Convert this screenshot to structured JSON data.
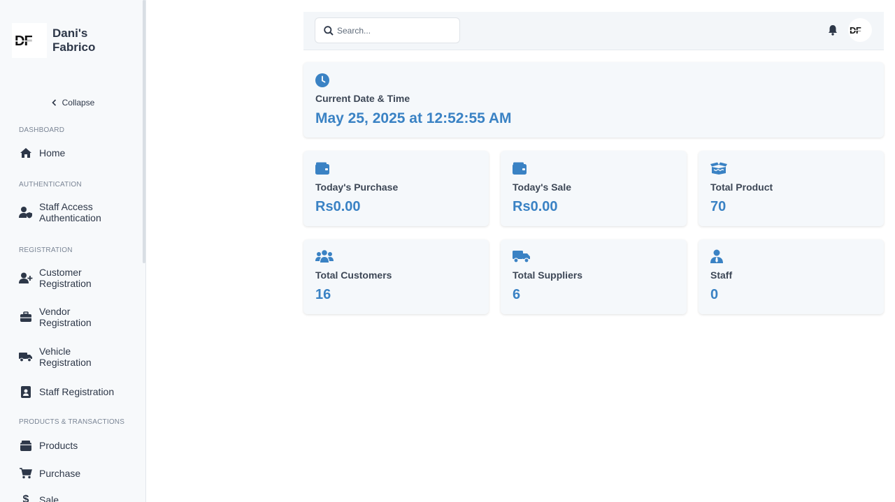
{
  "brand": {
    "name": "Dani's Fabrico",
    "logo_text": "DF"
  },
  "sidebar": {
    "collapse_label": "Collapse",
    "sections": [
      {
        "title": "DASHBOARD",
        "items": [
          {
            "label": "Home",
            "icon": "home-icon"
          }
        ]
      },
      {
        "title": "AUTHENTICATION",
        "items": [
          {
            "label": "Staff Access Authentication",
            "icon": "user-shield-icon"
          }
        ]
      },
      {
        "title": "REGISTRATION",
        "items": [
          {
            "label": "Customer Registration",
            "icon": "user-plus-icon"
          },
          {
            "label": "Vendor Registration",
            "icon": "briefcase-icon"
          },
          {
            "label": "Vehicle Registration",
            "icon": "truck-icon"
          },
          {
            "label": "Staff Registration",
            "icon": "id-badge-icon"
          }
        ]
      },
      {
        "title": "PRODUCTS & TRANSACTIONS",
        "items": [
          {
            "label": "Products",
            "icon": "box-icon"
          },
          {
            "label": "Purchase",
            "icon": "cart-icon"
          },
          {
            "label": "Sale",
            "icon": "dollar-icon"
          }
        ]
      }
    ]
  },
  "header": {
    "search_placeholder": "Search..."
  },
  "datetime_card": {
    "title": "Current Date & Time",
    "value": "May 25, 2025 at 12:52:55 AM",
    "icon": "clock-icon"
  },
  "stats": [
    {
      "title": "Today's Purchase",
      "value": "Rs0.00",
      "icon": "wallet-icon"
    },
    {
      "title": "Today's Sale",
      "value": "Rs0.00",
      "icon": "wallet-icon"
    },
    {
      "title": "Total Product",
      "value": "70",
      "icon": "box-open-icon"
    },
    {
      "title": "Total Customers",
      "value": "16",
      "icon": "users-icon"
    },
    {
      "title": "Total Suppliers",
      "value": "6",
      "icon": "truck-icon"
    },
    {
      "title": "Staff",
      "value": "0",
      "icon": "user-tie-icon"
    }
  ],
  "colors": {
    "accent": "#3a82c4",
    "sidebar_bg": "#f7f9fb",
    "card_bg": "#f5f8fb",
    "text": "#2d3748"
  }
}
